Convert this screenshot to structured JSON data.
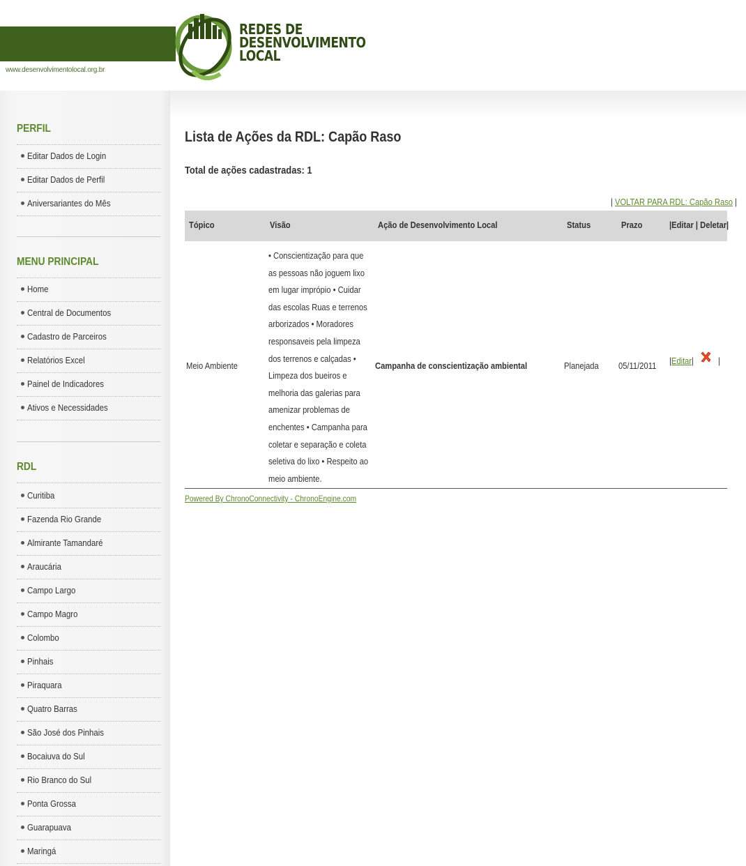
{
  "header": {
    "site_url": "www.desenvolvimentolocal.org.br",
    "logo_line1": "REDES DE",
    "logo_line2": "DESENVOLVIMENTO",
    "logo_line3": "LOCAL",
    "brand_color": "#3e621d",
    "logo_icon": "globe-city-logo"
  },
  "sidebar": {
    "perfil_title": "PERFIL",
    "perfil_items": [
      {
        "label": "Editar Dados de Login"
      },
      {
        "label": "Editar Dados de Perfil"
      },
      {
        "label": "Aniversariantes do Mês"
      }
    ],
    "menu_title": "MENU PRINCIPAL",
    "menu_items": [
      {
        "label": "Home"
      },
      {
        "label": "Central de Documentos"
      },
      {
        "label": "Cadastro de Parceiros"
      },
      {
        "label": "Relatórios Excel"
      },
      {
        "label": "Painel de Indicadores"
      },
      {
        "label": "Ativos e Necessidades"
      }
    ],
    "rdl_title": "RDL",
    "rdl_items": [
      {
        "label": "Curitiba"
      },
      {
        "label": "Fazenda Rio Grande"
      },
      {
        "label": "Almirante Tamandaré"
      },
      {
        "label": "Araucária"
      },
      {
        "label": "Campo Largo"
      },
      {
        "label": "Campo Magro"
      },
      {
        "label": "Colombo"
      },
      {
        "label": "Pinhais"
      },
      {
        "label": "Piraquara"
      },
      {
        "label": "Quatro Barras"
      },
      {
        "label": "São José dos Pinhais"
      },
      {
        "label": "Bocaiuva do Sul"
      },
      {
        "label": "Rio Branco do Sul"
      },
      {
        "label": "Ponta Grossa"
      },
      {
        "label": "Guarapuava"
      },
      {
        "label": "Maringá"
      }
    ],
    "accent_color": "#5e8a2e"
  },
  "main": {
    "title": "Lista de Ações da RDL: Capão Raso",
    "total": "Total de ações cadastradas: 1",
    "back_link": "VOLTAR PARA RDL: Capão Raso",
    "columns": {
      "topico": "Tópico",
      "visao": "Visão",
      "acao": "Ação de Desenvolvimento Local",
      "status": "Status",
      "prazo": "Prazo",
      "actions": "|Editar | Deletar|"
    },
    "row": {
      "topico": "Meio Ambiente",
      "visao": "• Conscientização para que as pessoas não joguem lixo em lugar imprópio • Cuidar das escolas Ruas e terrenos arborizados • Moradores responsaveis pela limpeza dos terrenos e calçadas • Limpeza dos bueiros e melhoria das galerias para amenizar problemas de enchentes • Campanha para coletar e separação e coleta seletiva do lixo • Respeito ao meio ambiente.",
      "acao": "Campanha de conscientização ambiental",
      "status": "Planejada",
      "prazo": "05/11/2011",
      "edit_label": "Editar",
      "delete_icon": "delete-x-icon"
    },
    "powered_by": "Powered By ChronoConnectivity - ChronoEngine.com"
  }
}
